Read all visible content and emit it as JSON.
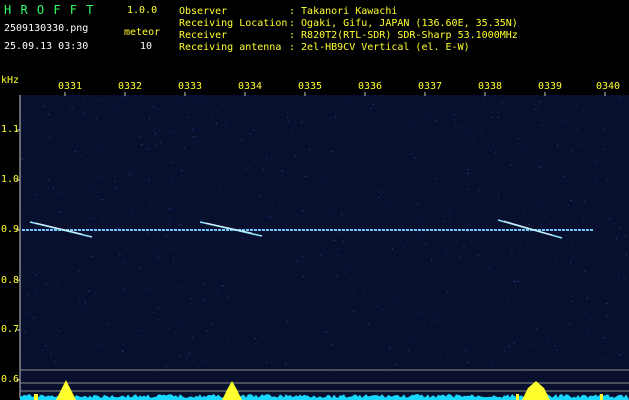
{
  "header": {
    "app_name": "H R O F F T",
    "version": "1.0.0",
    "file_name": "2509130330.png",
    "timestamp": "25.09.13 03:30",
    "meteor_label": "meteor",
    "meteor_count": "10",
    "info": [
      {
        "key": "Observer",
        "value": ": Takanori Kawachi"
      },
      {
        "key": "Receiving Location",
        "value": ": Ogaki, Gifu, JAPAN (136.60E, 35.35N)"
      },
      {
        "key": "Receiver",
        "value": ": R820T2(RTL-SDR) SDR-Sharp 53.1000MHz"
      },
      {
        "key": "Receiving antenna",
        "value": ": 2el-HB9CV Vertical (el. E-W)"
      }
    ]
  },
  "axis": {
    "unit": "kHz",
    "time_ticks": [
      "0331",
      "0332",
      "0333",
      "0334",
      "0335",
      "0336",
      "0337",
      "0338",
      "0339",
      "0340"
    ],
    "freq_ticks": [
      "1.1",
      "1.0",
      "0.9",
      "0.8",
      "0.7",
      "0.6"
    ]
  },
  "colors": {
    "label": "#ffff2e",
    "title": "#33ff66",
    "background": "#000000",
    "noise": "#08102e",
    "signal": "#6ec8ff",
    "level": "#19d8ff",
    "burst": "#ffff2e"
  }
}
